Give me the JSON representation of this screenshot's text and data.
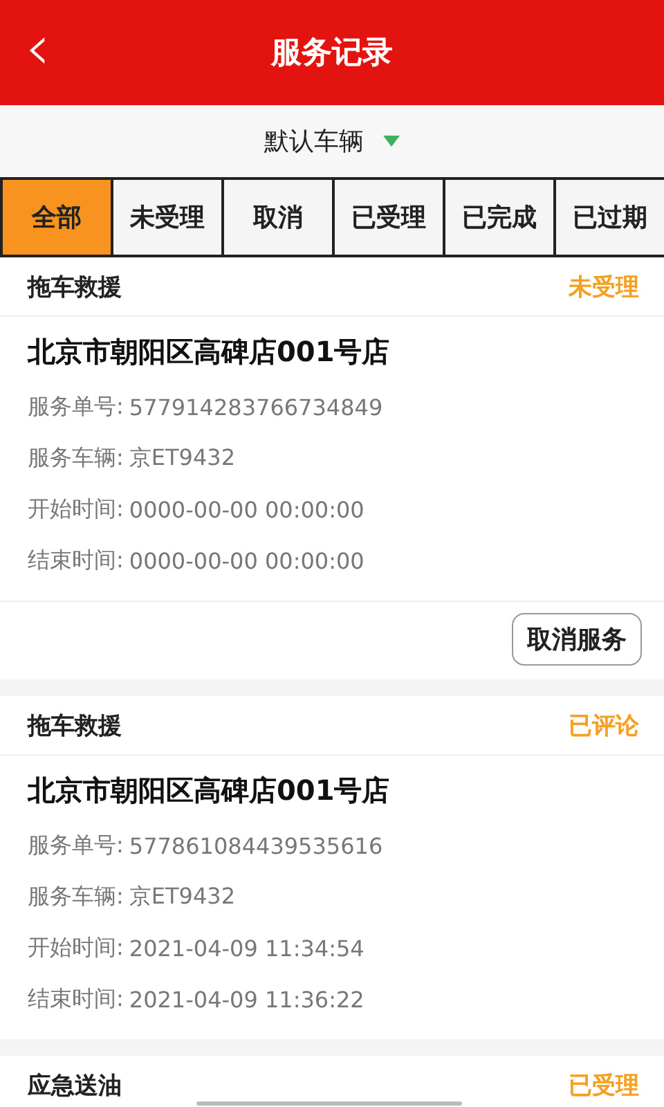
{
  "header": {
    "title": "服务记录",
    "back": "‹"
  },
  "vehicle_selector": {
    "label": "默认车辆"
  },
  "tabs": [
    {
      "label": "全部",
      "selected": true
    },
    {
      "label": "未受理",
      "selected": false
    },
    {
      "label": "取消",
      "selected": false
    },
    {
      "label": "已受理",
      "selected": false
    },
    {
      "label": "已完成",
      "selected": false
    },
    {
      "label": "已过期",
      "selected": false
    }
  ],
  "records": [
    {
      "service": "拖车救援",
      "status": "未受理",
      "address": "北京市朝阳区高碑店001号店",
      "fields": [
        {
          "label": "服务单号:",
          "value": "577914283766734849"
        },
        {
          "label": "服务车辆:",
          "value": "京ET9432"
        },
        {
          "label": "开始时间:",
          "value": "0000-00-00 00:00:00"
        },
        {
          "label": "结束时间:",
          "value": "0000-00-00 00:00:00"
        }
      ],
      "actions": [
        "取消服务"
      ]
    },
    {
      "service": "拖车救援",
      "status": "已评论",
      "address": "北京市朝阳区高碑店001号店",
      "fields": [
        {
          "label": "服务单号:",
          "value": "577861084439535616"
        },
        {
          "label": "服务车辆:",
          "value": "京ET9432"
        },
        {
          "label": "开始时间:",
          "value": "2021-04-09 11:34:54"
        },
        {
          "label": "结束时间:",
          "value": "2021-04-09 11:36:22"
        }
      ]
    },
    {
      "service": "应急送油",
      "status": "已受理"
    }
  ]
}
